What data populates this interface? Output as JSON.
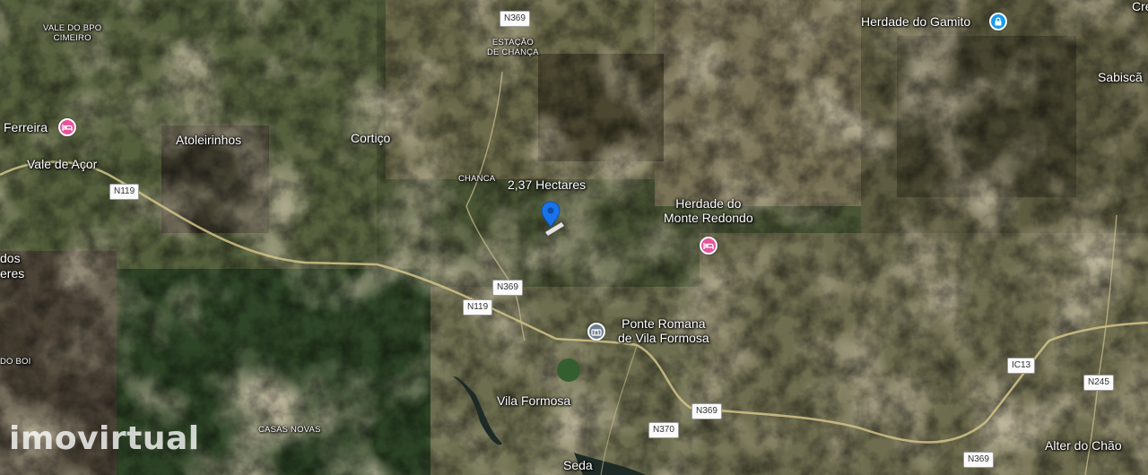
{
  "map": {
    "property_label": "2,37 Hectares",
    "places": {
      "ferreira": "Ferreira",
      "vale_de_acor": "Vale de Açor",
      "atoleirinhos": "Atoleirinhos",
      "cortico": "Cortiço",
      "chanca": "CHANCA",
      "estacao_de_chanca": "ESTAÇÃO\nDE CHANÇA",
      "vale_do_bpo_cimeiro": "VALE DO BPO\nCIMEIRO",
      "herdade_do_gamito": "Herdade do Gamito",
      "sabisca": "Sabiscã",
      "herdade_do_monte_redondo": "Herdade do\nMonte Redondo",
      "ponte_romana": "Ponte Romana\nde Vila Formosa",
      "vila_formosa": "Vila Formosa",
      "casas_novas": "CASAS NOVAS",
      "alter_do_chao": "Alter do Chão",
      "seda": "Seda",
      "dos": "dos",
      "eres": "eres",
      "do_boi": "DO BOI",
      "cre": "Cre"
    },
    "roads": {
      "n369_top": "N369",
      "n119_left": "N119",
      "n369_mid": "N369",
      "n119_mid": "N119",
      "n369_lower": "N369",
      "n370": "N370",
      "ic13": "IC13",
      "n245": "N245",
      "n369_bottom": "N369"
    },
    "poi_icons": {
      "hotel": "hotel-icon",
      "lock": "lock-icon",
      "landmark": "landmark-icon"
    },
    "colors": {
      "hotel_pin": "#e8539a",
      "lock_pin": "#1a9be8",
      "landmark_pin": "#6d7f8e",
      "location_pin": "#1a73e8"
    }
  },
  "watermark": "imovirtual"
}
